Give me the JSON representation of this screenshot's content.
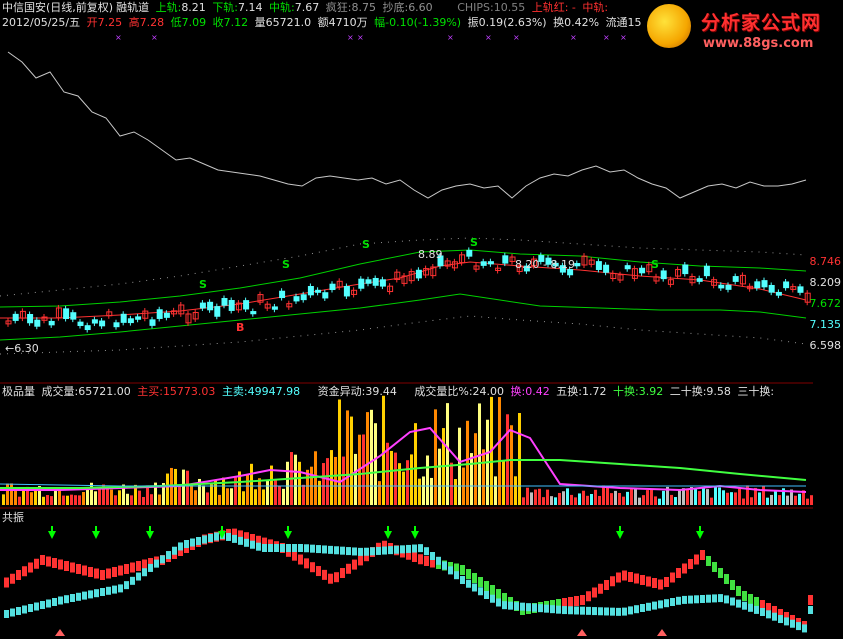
{
  "header1": {
    "stock": "中信国安(日线,前复权)",
    "indicator": "融轨道",
    "upper_label": "上轨:",
    "upper_value": "8.21",
    "lower_label": "下轨:",
    "lower_value": "7.14",
    "mid_label": "中轨:",
    "mid_value": "7.67",
    "crazy_label": "疯狂:",
    "crazy_value": "8.75",
    "bottom_label": "抄底:",
    "bottom_value": "6.60",
    "chips_label": "CHIPS:",
    "chips_value": "10.55",
    "upper_red": "上轨红: -",
    "mid_red": "中轨:"
  },
  "header2": {
    "date": "2012/05/25/五",
    "open": "开7.25",
    "high": "高7.28",
    "low": "低7.09",
    "close": "收7.12",
    "volume": "量65721.0",
    "amount": "额4710万",
    "change": "幅-0.10(-1.39%)",
    "amplitude": "振0.19(2.63%)",
    "turnover": "换0.42%",
    "float": "流通15.7亿"
  },
  "price_panel": {
    "right_labels": [
      "8.746",
      "8.209",
      "7.672",
      "7.135",
      "6.598"
    ],
    "marker_high": "8.89",
    "marker_mid": "8.20",
    "marker_mid2": "8.19",
    "marker_low": "6.30",
    "signal_s": "S",
    "signal_b": "B"
  },
  "volume_panel": {
    "name": "极品量",
    "vol_label": "成交量:",
    "vol_value": "65721.00",
    "buy_label": "主买:",
    "buy_value": "15773.03",
    "sell_label": "主卖:",
    "sell_value": "49947.98",
    "fund_label": "资金异动:",
    "fund_value": "39.44",
    "ratio_label": "成交量比%:",
    "ratio_value": "24.00",
    "turn_label": "换:",
    "turn_value": "0.42",
    "turn5_label": "五换:",
    "turn5_value": "1.72",
    "turn10_label": "十换:",
    "turn10_value": "3.92",
    "turn20_label": "二十换:",
    "turn20_value": "9.58",
    "turn30_label": "三十换:"
  },
  "resonance_panel": {
    "name": "共振"
  },
  "logo": {
    "title": "分析家公式网",
    "url": "www.88gs.com"
  },
  "colors": {
    "up": "#ff3232",
    "down": "#54ffff",
    "yellow": "#ffff00",
    "green": "#00e000",
    "magenta": "#ff00ff",
    "white_line": "#c8c8c8",
    "separator": "#800000"
  }
}
